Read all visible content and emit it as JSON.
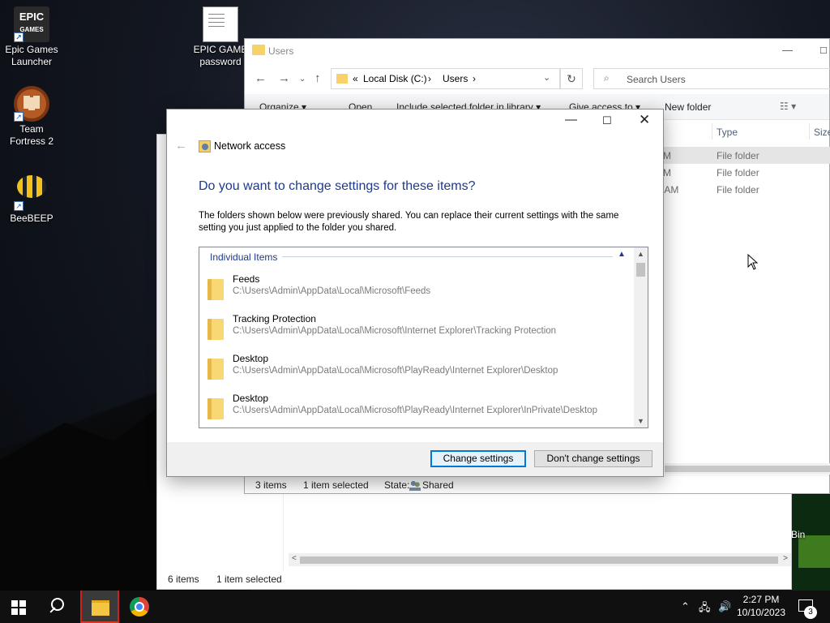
{
  "desktop": {
    "icons": [
      {
        "label": "Epic Games Launcher",
        "logo_text": "EPIC\nGAMES"
      },
      {
        "label": "EPIC GAME password"
      },
      {
        "label": "Team Fortress 2"
      },
      {
        "label": "BeeBEEP"
      },
      {
        "label": "e Bin"
      }
    ]
  },
  "back_window": {
    "status_items": "6 items",
    "status_selected": "1 item selected"
  },
  "users_window": {
    "title": "Users",
    "address": {
      "prefix": "«",
      "drive": "Local Disk (C:)",
      "sep1": "›",
      "folder": "Users",
      "sep2": "›"
    },
    "search_placeholder": "Search Users",
    "commands": [
      "Organize ▾",
      "Open",
      "Include selected folder in library ▾",
      "Give access to ▾",
      "New folder"
    ],
    "columns": {
      "type": "Type",
      "size": "Size"
    },
    "rows": [
      {
        "date_tail": "M",
        "type": "File folder"
      },
      {
        "date_tail": "M",
        "type": "File folder"
      },
      {
        "date_tail": "5 AM",
        "type": "File folder"
      }
    ],
    "status": {
      "items": "3 items",
      "selected": "1 item selected",
      "state_label": "State:",
      "state_value": "Shared"
    }
  },
  "dialog": {
    "title": "Network access",
    "heading": "Do you want to change settings for these items?",
    "description": "The folders shown below were previously shared. You can replace their current settings with the same setting you just applied to the folder you shared.",
    "group_label": "Individual Items",
    "items": [
      {
        "name": "Feeds",
        "path": "C:\\Users\\Admin\\AppData\\Local\\Microsoft\\Feeds"
      },
      {
        "name": "Tracking Protection",
        "path": "C:\\Users\\Admin\\AppData\\Local\\Microsoft\\Internet Explorer\\Tracking Protection"
      },
      {
        "name": "Desktop",
        "path": "C:\\Users\\Admin\\AppData\\Local\\Microsoft\\PlayReady\\Internet Explorer\\Desktop"
      },
      {
        "name": "Desktop",
        "path": "C:\\Users\\Admin\\AppData\\Local\\Microsoft\\PlayReady\\Internet Explorer\\InPrivate\\Desktop"
      }
    ],
    "buttons": {
      "change": "Change settings",
      "dont_change": "Don't change settings"
    }
  },
  "taskbar": {
    "time": "2:27 PM",
    "date": "10/10/2023",
    "notification_count": "3"
  },
  "colors": {
    "accent": "#0078d7",
    "heading": "#1e3a8a",
    "taskbar": "#101010"
  }
}
